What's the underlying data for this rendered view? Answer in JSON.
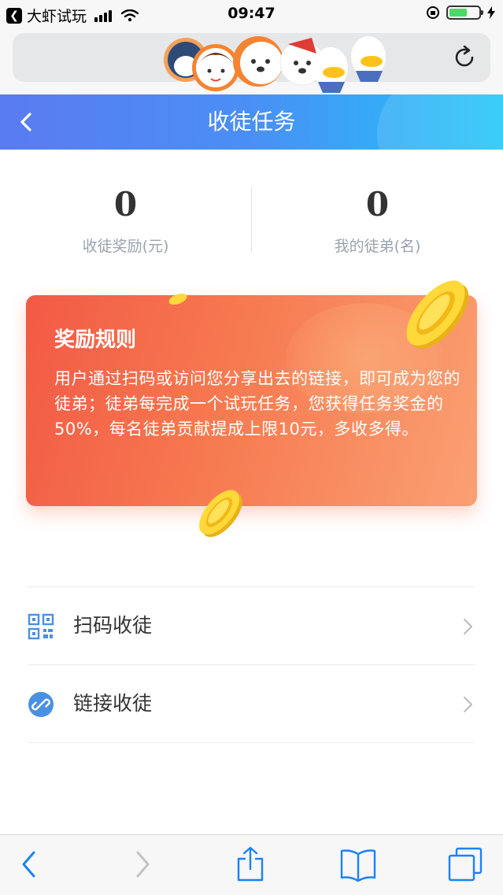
{
  "status_bar": {
    "back_app_label": "大虾试玩",
    "time": "09:47",
    "battery_level": 0.6
  },
  "nav": {
    "title": "收徒任务"
  },
  "stats": [
    {
      "value": "0",
      "label": "收徒奖励(元)"
    },
    {
      "value": "0",
      "label": "我的徒弟(名)"
    }
  ],
  "reward_card": {
    "title": "奖励规则",
    "text": "用户通过扫码或访问您分享出去的链接，即可成为您的徒弟；徒弟每完成一个试玩任务，您获得任务奖金的50%，每名徒弟贡献提成上限10元，多收多得。"
  },
  "options": [
    {
      "label": "扫码收徒",
      "icon": "qr-code-icon"
    },
    {
      "label": "链接收徒",
      "icon": "link-icon"
    }
  ],
  "colors": {
    "nav_gradient_start": "#5a7bf2",
    "nav_gradient_end": "#21c6f7",
    "card_gradient_start": "#f25a45",
    "card_gradient_end": "#faa073",
    "toolbar_icon": "#1a82fb",
    "icon_blue": "#4a90e2"
  }
}
